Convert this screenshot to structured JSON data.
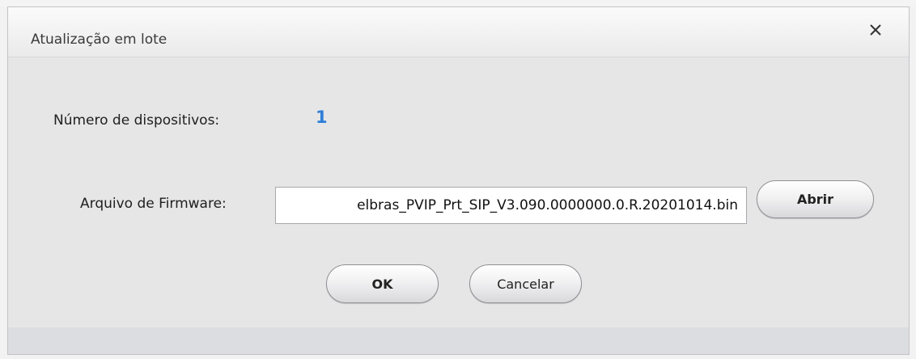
{
  "dialog": {
    "title": "Atualização em lote",
    "close_glyph": "✕"
  },
  "devices": {
    "label": "Número de dispositivos:",
    "count": "1"
  },
  "firmware": {
    "label": "Arquivo de Firmware:",
    "value": "elbras_PVIP_Prt_SIP_V3.090.0000000.0.R.20201014.bin"
  },
  "buttons": {
    "open_label": "Abrir",
    "ok_label": "OK",
    "cancel_label": "Cancelar"
  },
  "colors": {
    "accent_count": "#2f7fd8",
    "dialog_bg": "#e7e7e8",
    "titlebar_bg": "#f3f3f4"
  },
  "icons": {
    "close": "close-icon"
  }
}
